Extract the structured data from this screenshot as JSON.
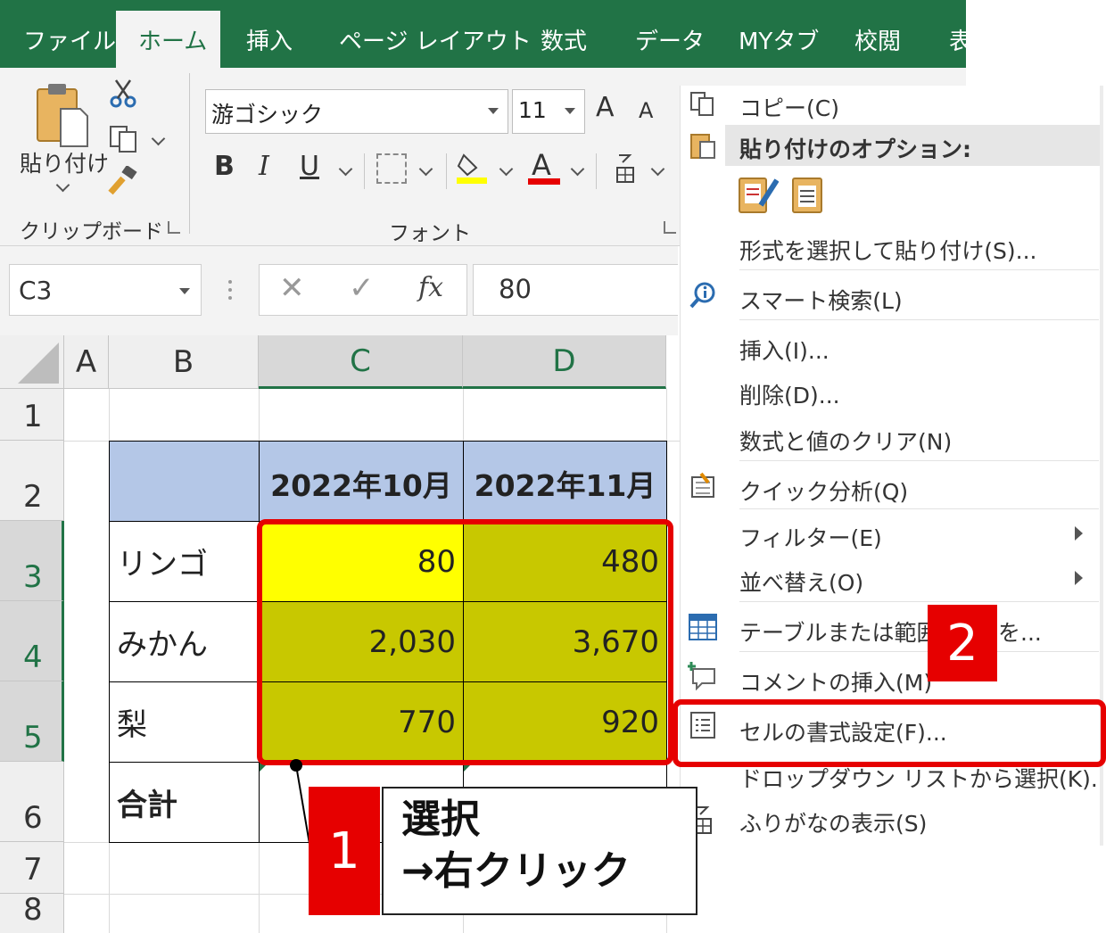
{
  "ribbon": {
    "tabs": [
      "ファイル",
      "ホーム",
      "挿入",
      "ページ レイアウト",
      "数式",
      "データ",
      "MYタブ",
      "校閲",
      "表"
    ],
    "clipboard": {
      "paste_label": "貼り付け",
      "group_label": "クリップボード"
    },
    "font": {
      "name": "游ゴシック",
      "size": "11",
      "group_label": "フォント",
      "bold": "B",
      "italic": "I",
      "underline": "U",
      "grow": "A",
      "shrink": "A",
      "font_color_glyph": "A"
    }
  },
  "formula_bar": {
    "cell_ref": "C3",
    "fx": "fx",
    "value": "80"
  },
  "sheet": {
    "columns": [
      "A",
      "B",
      "C",
      "D"
    ],
    "rows": [
      "1",
      "2",
      "3",
      "4",
      "5",
      "6",
      "7",
      "8"
    ],
    "headers": [
      "2022年10月",
      "2022年11月"
    ],
    "data": [
      {
        "label": "リンゴ",
        "oct": "80",
        "nov": "480"
      },
      {
        "label": "みかん",
        "oct": "2,030",
        "nov": "3,670"
      },
      {
        "label": "梨",
        "oct": "770",
        "nov": "920"
      }
    ],
    "total_label": "合計"
  },
  "context_menu": {
    "copy": "コピー(C)",
    "paste_options": "貼り付けのオプション:",
    "paste_special": "形式を選択して貼り付け(S)...",
    "smart_lookup": "スマート検索(L)",
    "insert": "挿入(I)...",
    "delete": "削除(D)...",
    "clear": "数式と値のクリア(N)",
    "quick_analysis": "クイック分析(Q)",
    "filter": "フィルター(E)",
    "sort": "並べ替え(O)",
    "table": "テーブルまたは範囲か",
    "table_tail": "を...",
    "comment": "コメントの挿入(M)",
    "format_cells": "セルの書式設定(F)...",
    "dropdown": "ドロップダウン リストから選択(K)...",
    "phonetic": "ふりがなの表示(S)"
  },
  "annotations": {
    "step1": "1",
    "step2": "2",
    "callout_line1": "選択",
    "callout_line2": "→右クリック"
  },
  "colors": {
    "excel_green": "#217346",
    "highlight_yellow": "#ffff00",
    "olive_fill": "#c8c800",
    "header_blue": "#b4c7e7",
    "annotation_red": "#e60000"
  }
}
